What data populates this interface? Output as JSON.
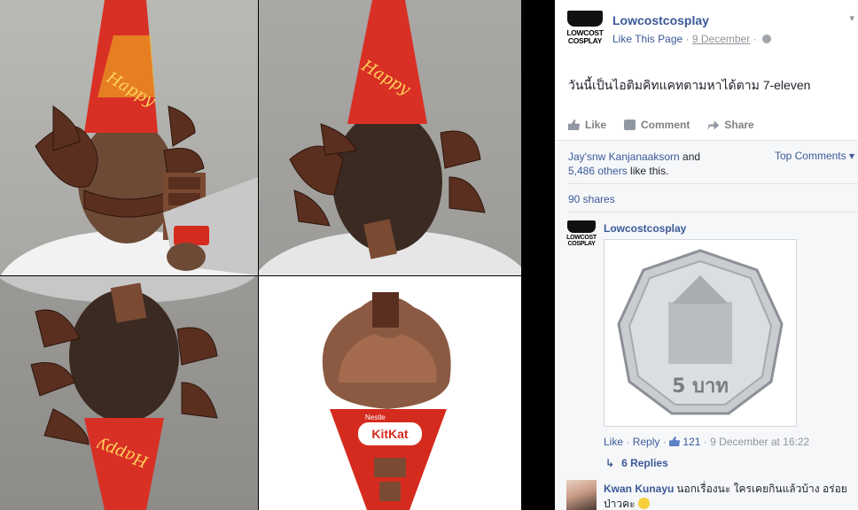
{
  "photo": {
    "wrapper_text_top": "Happy",
    "wrapper_text_top_right": "Happy",
    "wrapper_text_bottom": "Happy",
    "kitkat_label": "KitKat",
    "nestle_label": "Nestle"
  },
  "post": {
    "page_name": "Lowcostcosplay",
    "logo_text_line1": "LOWCOST",
    "logo_text_line2": "COSPLAY",
    "like_page": "Like This Page",
    "date": "9 December",
    "separator": "·",
    "text": "วันนี้เป็นไอติมคิทแคทตามหาได้ตาม 7-eleven",
    "actions": {
      "like": "Like",
      "comment": "Comment",
      "share": "Share"
    }
  },
  "feedback": {
    "liker_name": "Jay'snw Kanjanaaksorn",
    "and_text": " and",
    "others_count": "5,486 others",
    "like_this": " like this.",
    "top_comments": "Top Comments ▾",
    "shares": "90 shares"
  },
  "comments": [
    {
      "author": "Lowcostcosplay",
      "logo_text_line1": "LOWCOST",
      "logo_text_line2": "COSPLAY",
      "coin_text": "5 บาท",
      "like": "Like",
      "reply": "Reply",
      "like_count": "121",
      "timestamp": "9 December at 16:22",
      "replies": "6 Replies"
    },
    {
      "author": "Kwan Kunayu",
      "text": "นอกเรื่องนะ ใครเคยกินแล้วบ้าง อร่อยป่าวคะ"
    }
  ],
  "colors": {
    "facebook_blue": "#3b5998",
    "kitkat_red": "#d52b1e",
    "chocolate": "#6b3a2a"
  }
}
